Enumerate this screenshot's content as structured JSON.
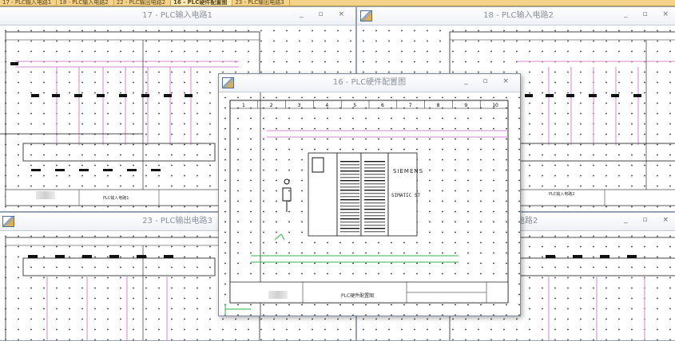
{
  "tabs": [
    {
      "label": "17 - PLC输入电路1",
      "active": false
    },
    {
      "label": "18 - PLC输入电路2",
      "active": false
    },
    {
      "label": "22 - PLC输出电路2",
      "active": false
    },
    {
      "label": "16 - PLC硬件配置图",
      "active": true
    },
    {
      "label": "23 - PLC输出电路3",
      "active": false
    }
  ],
  "windows": {
    "w17": {
      "title": "17 - PLC输入电路1",
      "sheet_title": "PLC输入电路1"
    },
    "w18": {
      "title": "18 - PLC输入电路2",
      "sheet_title": "PLC输入电路2"
    },
    "w23": {
      "title": "23 - PLC输出电路3"
    },
    "w22": {
      "title_fragment": "出电路2"
    },
    "w16": {
      "title": "16 - PLC硬件配置图",
      "sheet_title": "PLC硬件配置图",
      "brand": "SIEMENS",
      "model": "SIMATIC S7"
    }
  },
  "ruler_numbers": [
    "1",
    "2",
    "3",
    "4",
    "5",
    "6",
    "7",
    "8",
    "9",
    "10"
  ],
  "colors": {
    "tab_bg": "#f4d28a",
    "wire_pink": "#d58ad0",
    "wire_green": "#33b54a",
    "drawing_black": "#111111"
  }
}
